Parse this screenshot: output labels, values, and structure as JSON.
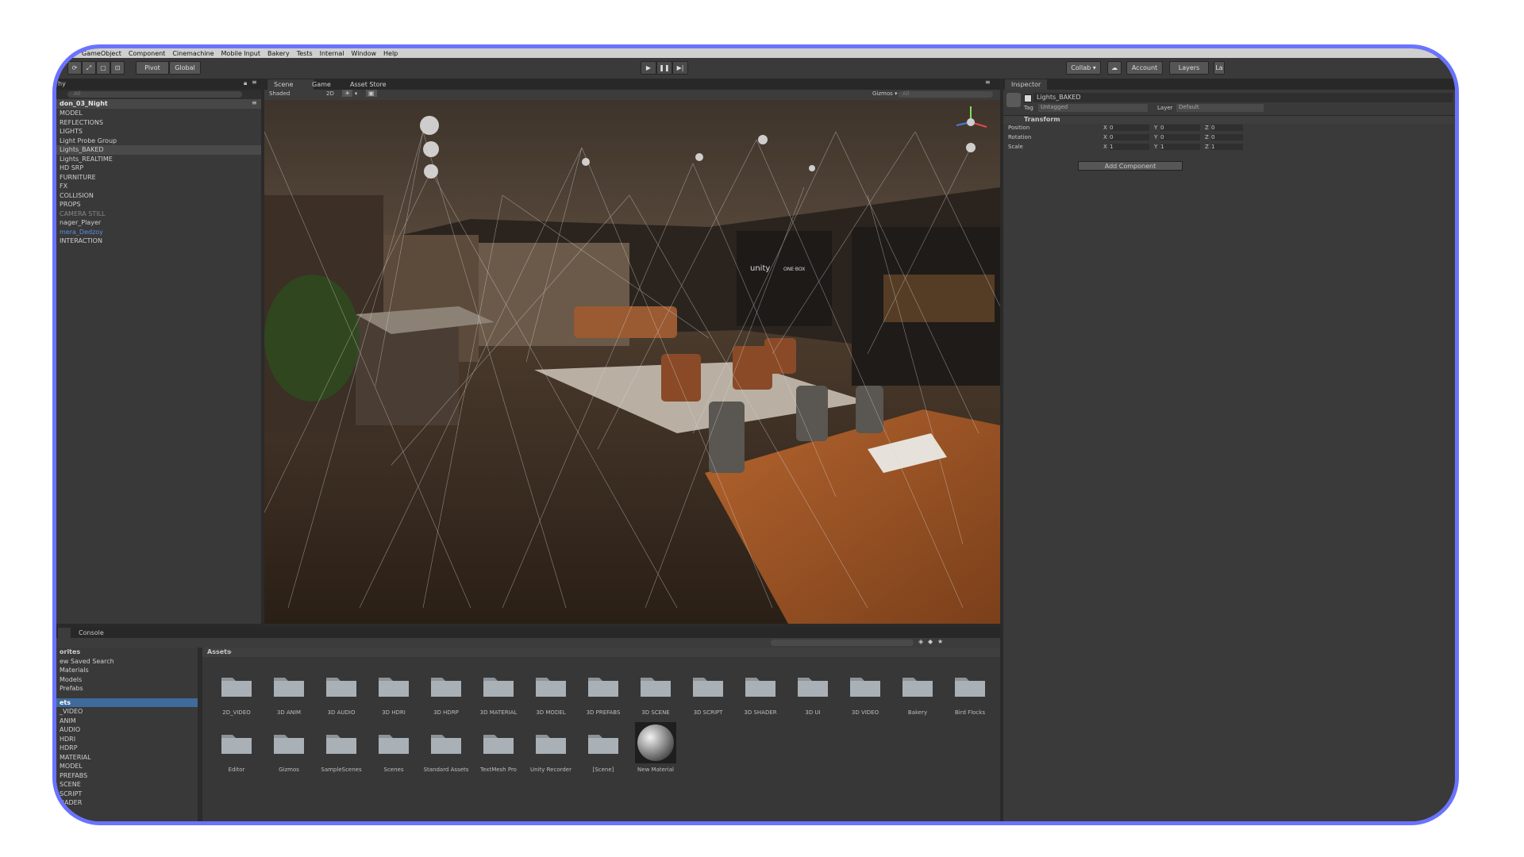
{
  "menu": [
    "GameObject",
    "Component",
    "Cinemachine",
    "Mobile Input",
    "Bakery",
    "Tests",
    "Internal",
    "Window",
    "Help"
  ],
  "toolbar": {
    "pivot_label": "Pivot",
    "global_label": "Global",
    "collab_label": "Collab ▾",
    "account_label": "Account",
    "layers_label": "Layers",
    "layout_label": "La"
  },
  "hierarchy": {
    "tab_label": "hy",
    "search_placeholder": "All",
    "scene_name": "don_03_Night",
    "items": [
      "MODEL",
      "REFLECTIONS",
      "LIGHTS",
      "Light Probe Group",
      "Lights_BAKED",
      "Lights_REALTIME",
      "HD SRP",
      "FURNITURE",
      "FX",
      "COLLISION",
      "PROPS",
      "CAMERA STILL",
      "nager_Player",
      "mera_Dedzoy",
      "INTERACTION"
    ],
    "selected_index": 4
  },
  "scene": {
    "tabs": [
      "Scene",
      "Game",
      "Asset Store"
    ],
    "shading_mode": "Shaded",
    "mode_2d": "2D",
    "gizmos_label": "Gizmos ▾",
    "search_placeholder": "All",
    "sign_label_1": "unity",
    "sign_label_2": "ONE·BOX"
  },
  "inspector": {
    "tab_label": "Inspector",
    "object_name": "Lights_BAKED",
    "tag_label": "Tag",
    "tag_value": "Untagged",
    "layer_label": "Layer",
    "layer_value": "Default",
    "component_title": "Transform",
    "rows": [
      {
        "label": "Position",
        "x": "0",
        "y": "0",
        "z": "0"
      },
      {
        "label": "Rotation",
        "x": "0",
        "y": "0",
        "z": "0"
      },
      {
        "label": "Scale",
        "x": "1",
        "y": "1",
        "z": "1"
      }
    ],
    "add_component_label": "Add Component"
  },
  "project": {
    "console_tab": "Console",
    "breadcrumb": "Assets",
    "favorites": [
      "orites",
      "ew Saved Search",
      "Materials",
      "Models",
      "Prefabs"
    ],
    "assets_tree_header": "ets",
    "assets_tree": [
      "_VIDEO",
      "ANIM",
      "AUDIO",
      "HDRI",
      "HDRP",
      "MATERIAL",
      "MODEL",
      "PREFABS",
      "SCENE",
      "SCRIPT",
      "HADER"
    ],
    "folders_row1": [
      "2D_VIDEO",
      "3D ANIM",
      "3D AUDIO",
      "3D HDRI",
      "3D HDRP",
      "3D MATERIAL",
      "3D MODEL",
      "3D PREFABS",
      "3D SCENE",
      "3D SCRIPT",
      "3D SHADER",
      "3D UI",
      "3D VIDEO",
      "Bakery",
      "Bird Flocks"
    ],
    "folders_row2": [
      "Editor",
      "Gizmos",
      "SampleScenes",
      "Scenes",
      "Standard Assets",
      "TextMesh Pro",
      "Unity Recorder",
      "[Scene]",
      "New Material"
    ]
  },
  "colors": {
    "frame": "#6a73ff",
    "selection": "#3e6a9c",
    "panel": "#393939"
  }
}
